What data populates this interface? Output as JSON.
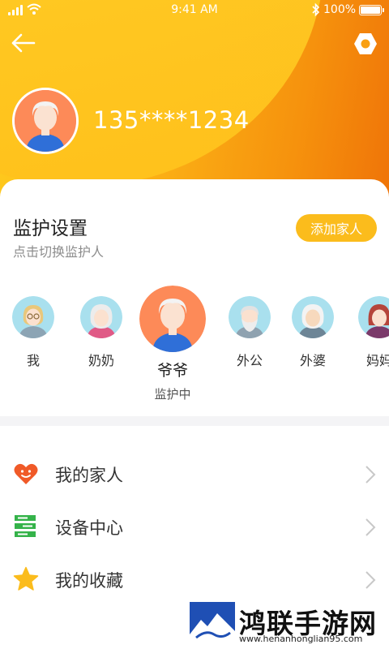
{
  "status_bar": {
    "time": "9:41 AM",
    "battery": "100%"
  },
  "header": {
    "phone": "135****1234",
    "back_icon": "back-arrow-icon",
    "settings_icon": "hexagon-gear-icon"
  },
  "guardian": {
    "title": "监护设置",
    "subtitle": "点击切换监护人",
    "add_button": "添加家人",
    "members": [
      {
        "name": "我"
      },
      {
        "name": "奶奶"
      },
      {
        "name": "爷爷",
        "status": "监护中",
        "active": true
      },
      {
        "name": "外公"
      },
      {
        "name": "外婆"
      },
      {
        "name": "妈妈"
      }
    ]
  },
  "menu": [
    {
      "label": "我的家人",
      "icon": "heart-face-icon",
      "color": "#f05a28"
    },
    {
      "label": "设备中心",
      "icon": "device-stack-icon",
      "color": "#35b34a"
    },
    {
      "label": "我的收藏",
      "icon": "star-icon",
      "color": "#fbbc1c"
    }
  ],
  "watermark": {
    "title": "鸿联手游网",
    "url": "www.henanhonglian95.com"
  },
  "colors": {
    "accent": "#fbbc1c",
    "header_start": "#ffcc1e",
    "header_end": "#ef7308"
  }
}
